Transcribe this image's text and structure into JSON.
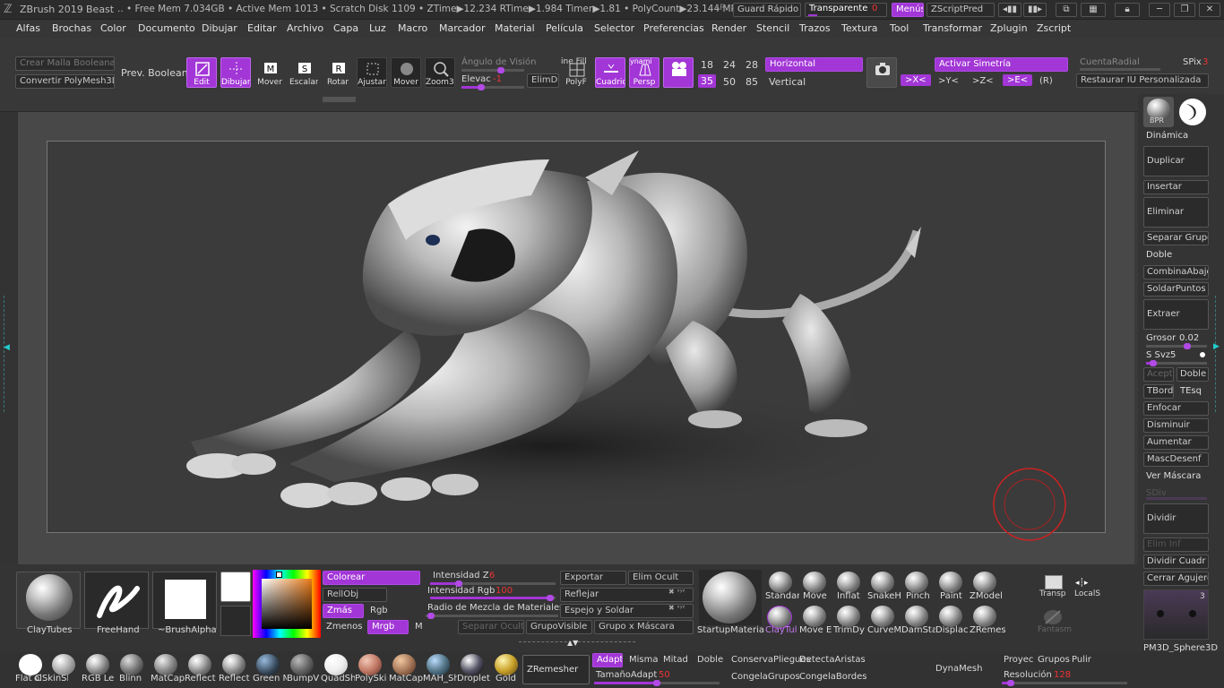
{
  "titlebar": {
    "app": "ZBrush 2019",
    "doc": "Beast",
    "stats": ".. • Free Mem 7.034GB • Active Mem 1013 • Scratch Disk 1109 • ZTime▶12.234 RTime▶1.984 Timer▶1.81 • PolyCount▶23.144 MP",
    "ar": "AR",
    "quicksave": "Guard Rápido",
    "transparent_label": "Transparente",
    "transparent_value": "0",
    "menus": "Menús",
    "zscript": "ZScriptPred"
  },
  "menus": [
    "Alfas",
    "Brochas",
    "Color",
    "Documento",
    "Dibujar",
    "Editar",
    "Archivo",
    "Capa",
    "Luz",
    "Macro",
    "Marcador",
    "Material",
    "Película",
    "Selector",
    "Preferencias",
    "Render",
    "Stencil",
    "Trazos",
    "Textura",
    "Tool",
    "Transformar",
    "Zplugin",
    "Zscript"
  ],
  "shelf": {
    "boolean_mesh": "Crear Malla Booleana",
    "convert_poly": "Convertir PolyMesh3D",
    "prev_boolean": "Prev. Booleana",
    "edit": "Edit",
    "draw": "Dibujar",
    "move": "Mover",
    "scale": "Escalar",
    "rotate": "Rotar",
    "fit": "Ajustar",
    "move2": "Mover",
    "zoom3d": "Zoom3D",
    "view_angle": "Ángulo de Visión",
    "elevation_label": "Elevac",
    "elevation_value": "-1",
    "elimdi": "ElimDi",
    "linefill_top": "ine Fill",
    "polyf": "PolyF",
    "grid": "Cuadric",
    "dynamic_top": "ynami",
    "persp": "Persp",
    "numbers_row1": [
      "18",
      "24",
      "28"
    ],
    "numbers_row2": [
      "35",
      "50",
      "85"
    ],
    "horizontal": "Horizontal",
    "vertical": "Vertical",
    "activate_symmetry": "Activar Simetría",
    "sym_x": ">X<",
    "sym_y": ">Y<",
    "sym_z": ">Z<",
    "sym_e": ">E<",
    "sym_r": "(R)",
    "radial_count": "CuentaRadial",
    "spix_label": "SPix",
    "spix_value": "3",
    "restore_ui": "Restaurar IU Personalizada"
  },
  "right_panel": {
    "bpr": "BPR",
    "dynamic": "Dinámica",
    "duplicate": "Duplicar",
    "insert": "Insertar",
    "delete": "Eliminar",
    "split_group": "Separar Grupo",
    "double": "Doble",
    "merge_down": "CombinaAbajo",
    "weld_points": "SoldarPuntos",
    "extract": "Extraer",
    "thickness_label": "Grosor",
    "thickness_value": "0.02",
    "ssvz_label": "S Svz",
    "ssvz_value": "5",
    "accept": "Acept",
    "double2": "Doble",
    "tbord": "TBord",
    "tesq": "TEsq",
    "focus": "Enfocar",
    "shrink": "Disminuir",
    "grow": "Aumentar",
    "unmask": "MascDesenf",
    "show_mask": "Ver Máscara",
    "sdiv": "SDiv",
    "divide": "Dividir",
    "del_lower": "Elim Inf",
    "divide_quad": "Dividir Cuadr",
    "close_holes": "Cerrar Agujero",
    "tool_count": "3",
    "tool_name": "PM3D_Sphere3D"
  },
  "bottom": {
    "brushes": [
      "ClayTubes",
      "FreeHand",
      "~BrushAlpha"
    ],
    "colorize": "Colorear",
    "fill_obj": "RellObj",
    "zadd": "Zmás",
    "zsub": "Zmenos",
    "rgb": "Rgb",
    "mrgb": "Mrgb",
    "m": "M",
    "z_intensity_label": "Intensidad Z",
    "z_intensity_value": "6",
    "rgb_intensity_label": "Intensidad Rgb",
    "rgb_intensity_value": "100",
    "mat_blend": "Radio de Mezcla de Materiales",
    "separate_hidden": "Separar Ocultos",
    "group_visible": "GrupoVisible",
    "group_by_mask": "Grupo x Máscara",
    "export": "Exportar",
    "delete_hidden": "Elim Ocult",
    "mirror": "Reflejar",
    "mirror_weld": "Espejo y Soldar",
    "startup_material": "StartupMateria",
    "brush_icons": [
      "Standar",
      "Move",
      "Inflat",
      "SnakeH",
      "Pinch",
      "Paint",
      "ZModel",
      "ClayTul",
      "Move E",
      "TrimDy",
      "CurveM",
      "DamSta",
      "Displac",
      "ZRemes"
    ],
    "transp": "Transp",
    "localsym": "LocalS",
    "fantasma": "Fantasm"
  },
  "materials": [
    "Flat C",
    "olSkinSha",
    "RGB Le",
    "Blinn",
    "MatCap",
    "Reflect",
    "Reflect",
    "Green M",
    "BumpV",
    "QuadSh",
    "PolySki",
    "MatCap",
    "MAH_Sh",
    "Droplet",
    "Gold"
  ],
  "zremesher": {
    "button": "ZRemesher",
    "adapt": "Adapt",
    "same": "Misma",
    "half": "Mitad",
    "double": "Doble",
    "size_label": "TamañoAdapt",
    "size_value": "50",
    "keep_creases": "ConservaPliegues",
    "detect_edges": "DetectaAristas",
    "freeze_groups": "CongelaGrupos",
    "freeze_borders": "CongelaBordes"
  },
  "dynamesh": {
    "label": "DynaMesh",
    "project": "Proyec",
    "groups": "Grupos",
    "polish": "Pulir",
    "resolution_label": "Resolución",
    "resolution_value": "128"
  }
}
